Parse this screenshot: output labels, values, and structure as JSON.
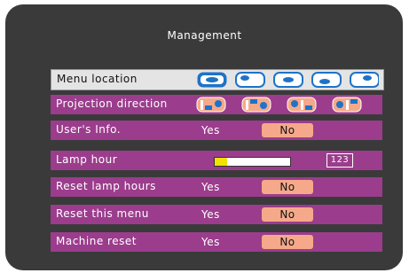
{
  "menu": {
    "title": "Management",
    "items": [
      {
        "label": "Menu location"
      },
      {
        "label": "Projection direction"
      },
      {
        "label": "User's Info.",
        "yes": "Yes",
        "no": "No"
      },
      {
        "label": "Lamp hour",
        "value": "123",
        "level": 0.17
      },
      {
        "label": "Reset lamp hours",
        "yes": "Yes",
        "no": "No"
      },
      {
        "label": "Reset this menu",
        "yes": "Yes",
        "no": "No"
      },
      {
        "label": "Machine reset",
        "yes": "Yes",
        "no": "No"
      }
    ],
    "colors": {
      "row": "#9b3d8c",
      "selected_row": "#e4e4e4",
      "no_button": "#f5a98a",
      "icon_blue": "#1e73c8",
      "lamp_fill": "#f2e200"
    },
    "location_icons": [
      "location-center-icon",
      "location-top-left-icon",
      "location-top-right-icon",
      "location-bottom-left-icon",
      "location-bottom-right-icon"
    ],
    "projection_icons": [
      "front-desktop-icon",
      "front-ceiling-icon",
      "rear-desktop-icon",
      "rear-ceiling-icon"
    ]
  }
}
